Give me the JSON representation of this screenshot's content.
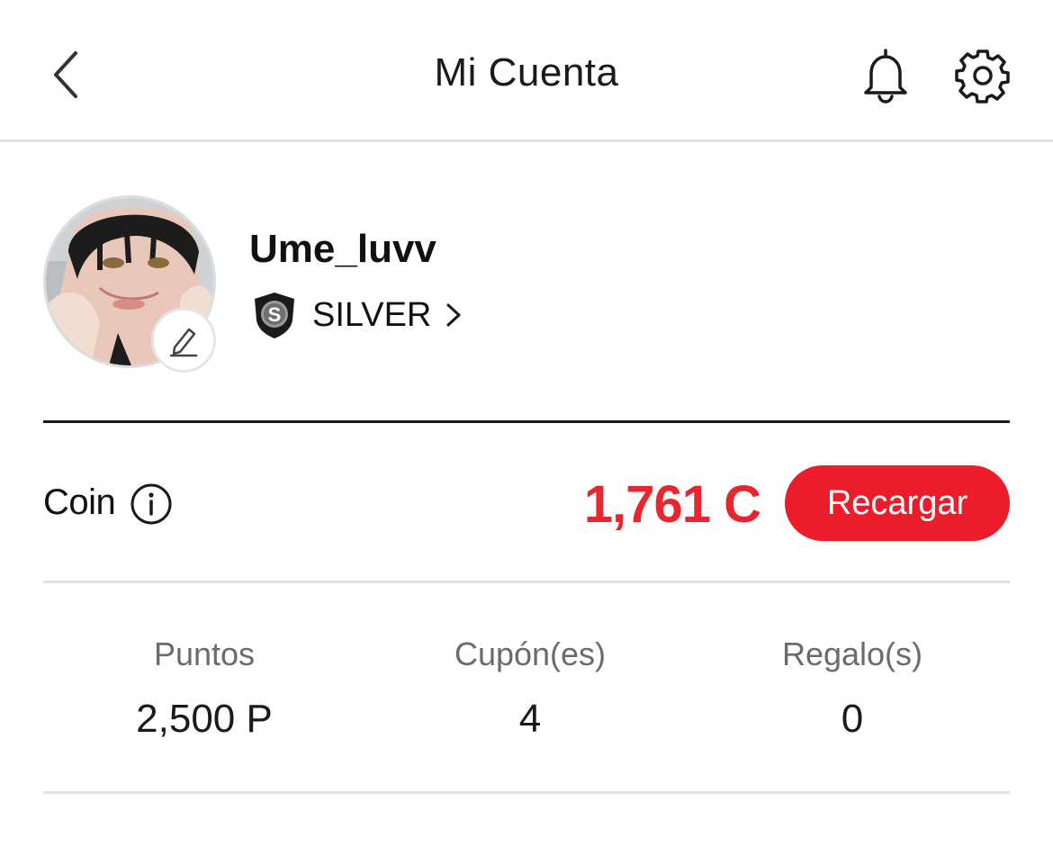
{
  "header": {
    "title": "Mi Cuenta",
    "back_icon": "chevron-left-icon",
    "notification_icon": "bell-icon",
    "settings_icon": "gear-icon"
  },
  "profile": {
    "username": "Ume_luvv",
    "tier": "SILVER",
    "tier_badge_letter": "S",
    "edit_icon": "pencil-icon"
  },
  "coin": {
    "label": "Coin",
    "amount": "1,761 C",
    "recharge_label": "Recargar",
    "accent_color": "#ec1c2a"
  },
  "stats": [
    {
      "label": "Puntos",
      "value": "2,500 P"
    },
    {
      "label": "Cupón(es)",
      "value": "4"
    },
    {
      "label": "Regalo(s)",
      "value": "0"
    }
  ]
}
